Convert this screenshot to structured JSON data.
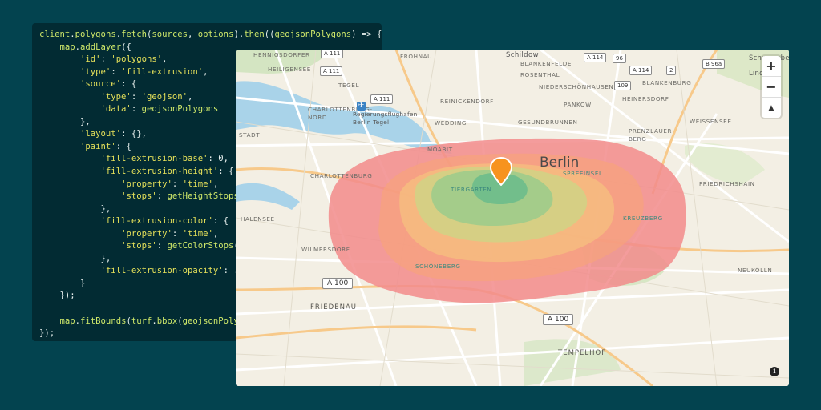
{
  "code": {
    "lines": [
      "client.polygons.fetch(sources, options).then((geojsonPolygons) => {",
      "    map.addLayer({",
      "        'id': 'polygons',",
      "        'type': 'fill-extrusion',",
      "        'source': {",
      "            'type': 'geojson',",
      "            'data': geojsonPolygons",
      "        },",
      "        'layout': {},",
      "        'paint': {",
      "            'fill-extrusion-base': 0,",
      "            'fill-extrusion-height': {",
      "                'property': 'time',",
      "                'stops': getHeightStops(",
      "            },",
      "            'fill-extrusion-color': {",
      "                'property': 'time',",
      "                'stops': getColorStops(t",
      "            },",
      "            'fill-extrusion-opacity': .5",
      "        }",
      "    });",
      "",
      "    map.fitBounds(turf.bbox(geojsonPolyg",
      "});"
    ]
  },
  "map": {
    "city_label": "Berlin",
    "district_labels": {
      "hennigsdorfer": "HENNIGSDORFER",
      "heiligensee": "HEILIGENSEE",
      "tegel": "TEGEL",
      "frohnau": "FROHNAU",
      "blankenfelde": "BLANKENFELDE",
      "rosenthal": "ROSENTHAL",
      "niederschonhausen": "NIEDERSCHÖNHAUSEN",
      "blankenburg": "BLANKENBURG",
      "reinickendorf": "REINICKENDORF",
      "heinersdorf": "HEINERSDORF",
      "pankow": "PANKOW",
      "wedding": "WEDDING",
      "gesundbrunnen": "GESUNDBRUNNEN",
      "charlottenburg_nord": "CHARLOTTENBURG-\nNORD",
      "stadt": "STADT",
      "moabit": "MOABIT",
      "prenzlauer_berg": "PRENZLAUER\nBERG",
      "weissensee": "WEISSENSEE",
      "charlottenburg": "CHARLOTTENBURG",
      "spreeinsel": "SPREEINSEL",
      "friedrichshain": "FRIEDRICHSHAIN",
      "tiergarten": "TIERGARTEN",
      "halensee": "HALENSEE",
      "kreuzberg": "KREUZBERG",
      "wilmersdorf": "WILMERSDORF",
      "schoneberg": "SCHÖNEBERG",
      "neukolln": "NEUKÖLLN",
      "friedenau": "FRIEDENAU",
      "tempelhof": "TEMPELHOF",
      "schildow": "Schildow",
      "schwanebeck": "Schwanebeck",
      "lindenberg": "Lind",
      "airport": "Regierungsflughafen\nBerlin Tegel"
    },
    "road_shields": {
      "a111_top": "A 111",
      "a111_left": "A 111",
      "a111_mid": "A 111",
      "a114_top": "A 114",
      "a114_mid": "A 114",
      "b96a": "B 96a",
      "a100_left": "A 100",
      "a100_right": "A 100",
      "num_109": "109",
      "num_2": "2",
      "num_5": "5",
      "num_96": "96"
    },
    "isochrone_colors": [
      "#f28b8b",
      "#f6a37c",
      "#f7c27f",
      "#c9d986",
      "#8fcb8d",
      "#5db88b"
    ],
    "controls": {
      "zoom_in": "+",
      "zoom_out": "−",
      "compass": "▲"
    },
    "info_label": "i",
    "marker_color": "#f7931e"
  }
}
